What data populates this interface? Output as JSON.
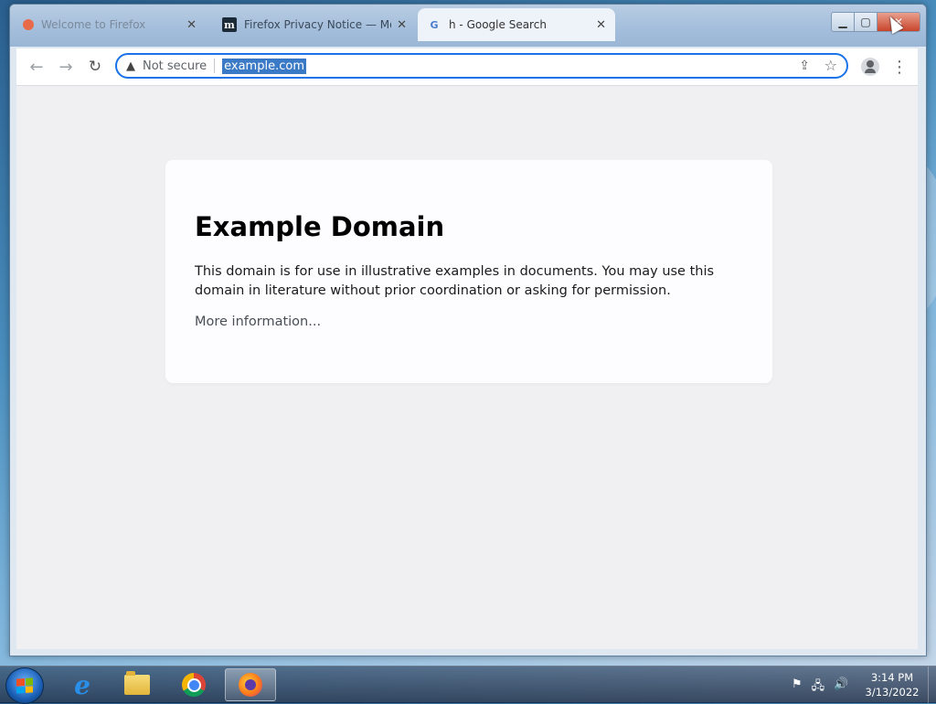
{
  "browser": {
    "tabs": [
      {
        "title": "Welcome to Firefox",
        "favicon": "firefox-favicon",
        "active": false
      },
      {
        "title": "Firefox Privacy Notice — Mozilla",
        "favicon": "mozilla-m-favicon",
        "favicon_text": "m",
        "active": false
      },
      {
        "title": "h - Google Search",
        "favicon": "google-g-favicon",
        "favicon_text": "G",
        "active": true
      }
    ],
    "tab_close_glyph": "✕",
    "window_controls": {
      "minimize": "▁",
      "maximize": "▢",
      "close": "✕"
    },
    "toolbar": {
      "back_glyph": "←",
      "forward_glyph": "→",
      "reload_glyph": "↻",
      "security_icon": "▲",
      "security_label": "Not secure",
      "url": "example.com",
      "share_glyph": "⇪",
      "bookmark_glyph": "☆",
      "menu_glyph": "⋮"
    }
  },
  "page": {
    "heading": "Example Domain",
    "body": "This domain is for use in illustrative examples in documents. You may use this domain in literature without prior coordination or asking for permission.",
    "link": "More information..."
  },
  "taskbar": {
    "pinned": [
      "internet-explorer",
      "windows-explorer",
      "google-chrome",
      "firefox"
    ],
    "active_app": "firefox",
    "tray_icons": [
      "action-center-flag",
      "network",
      "volume"
    ],
    "tray_glyphs": {
      "flag": "⚑",
      "network": "🖧",
      "volume": "🔊"
    },
    "time": "3:14 PM",
    "date": "3/13/2022"
  },
  "colors": {
    "accent": "#1a73e8",
    "url_selection": "#3a79c6",
    "close_button": "#c8442c",
    "page_background": "#f0f0f2"
  }
}
